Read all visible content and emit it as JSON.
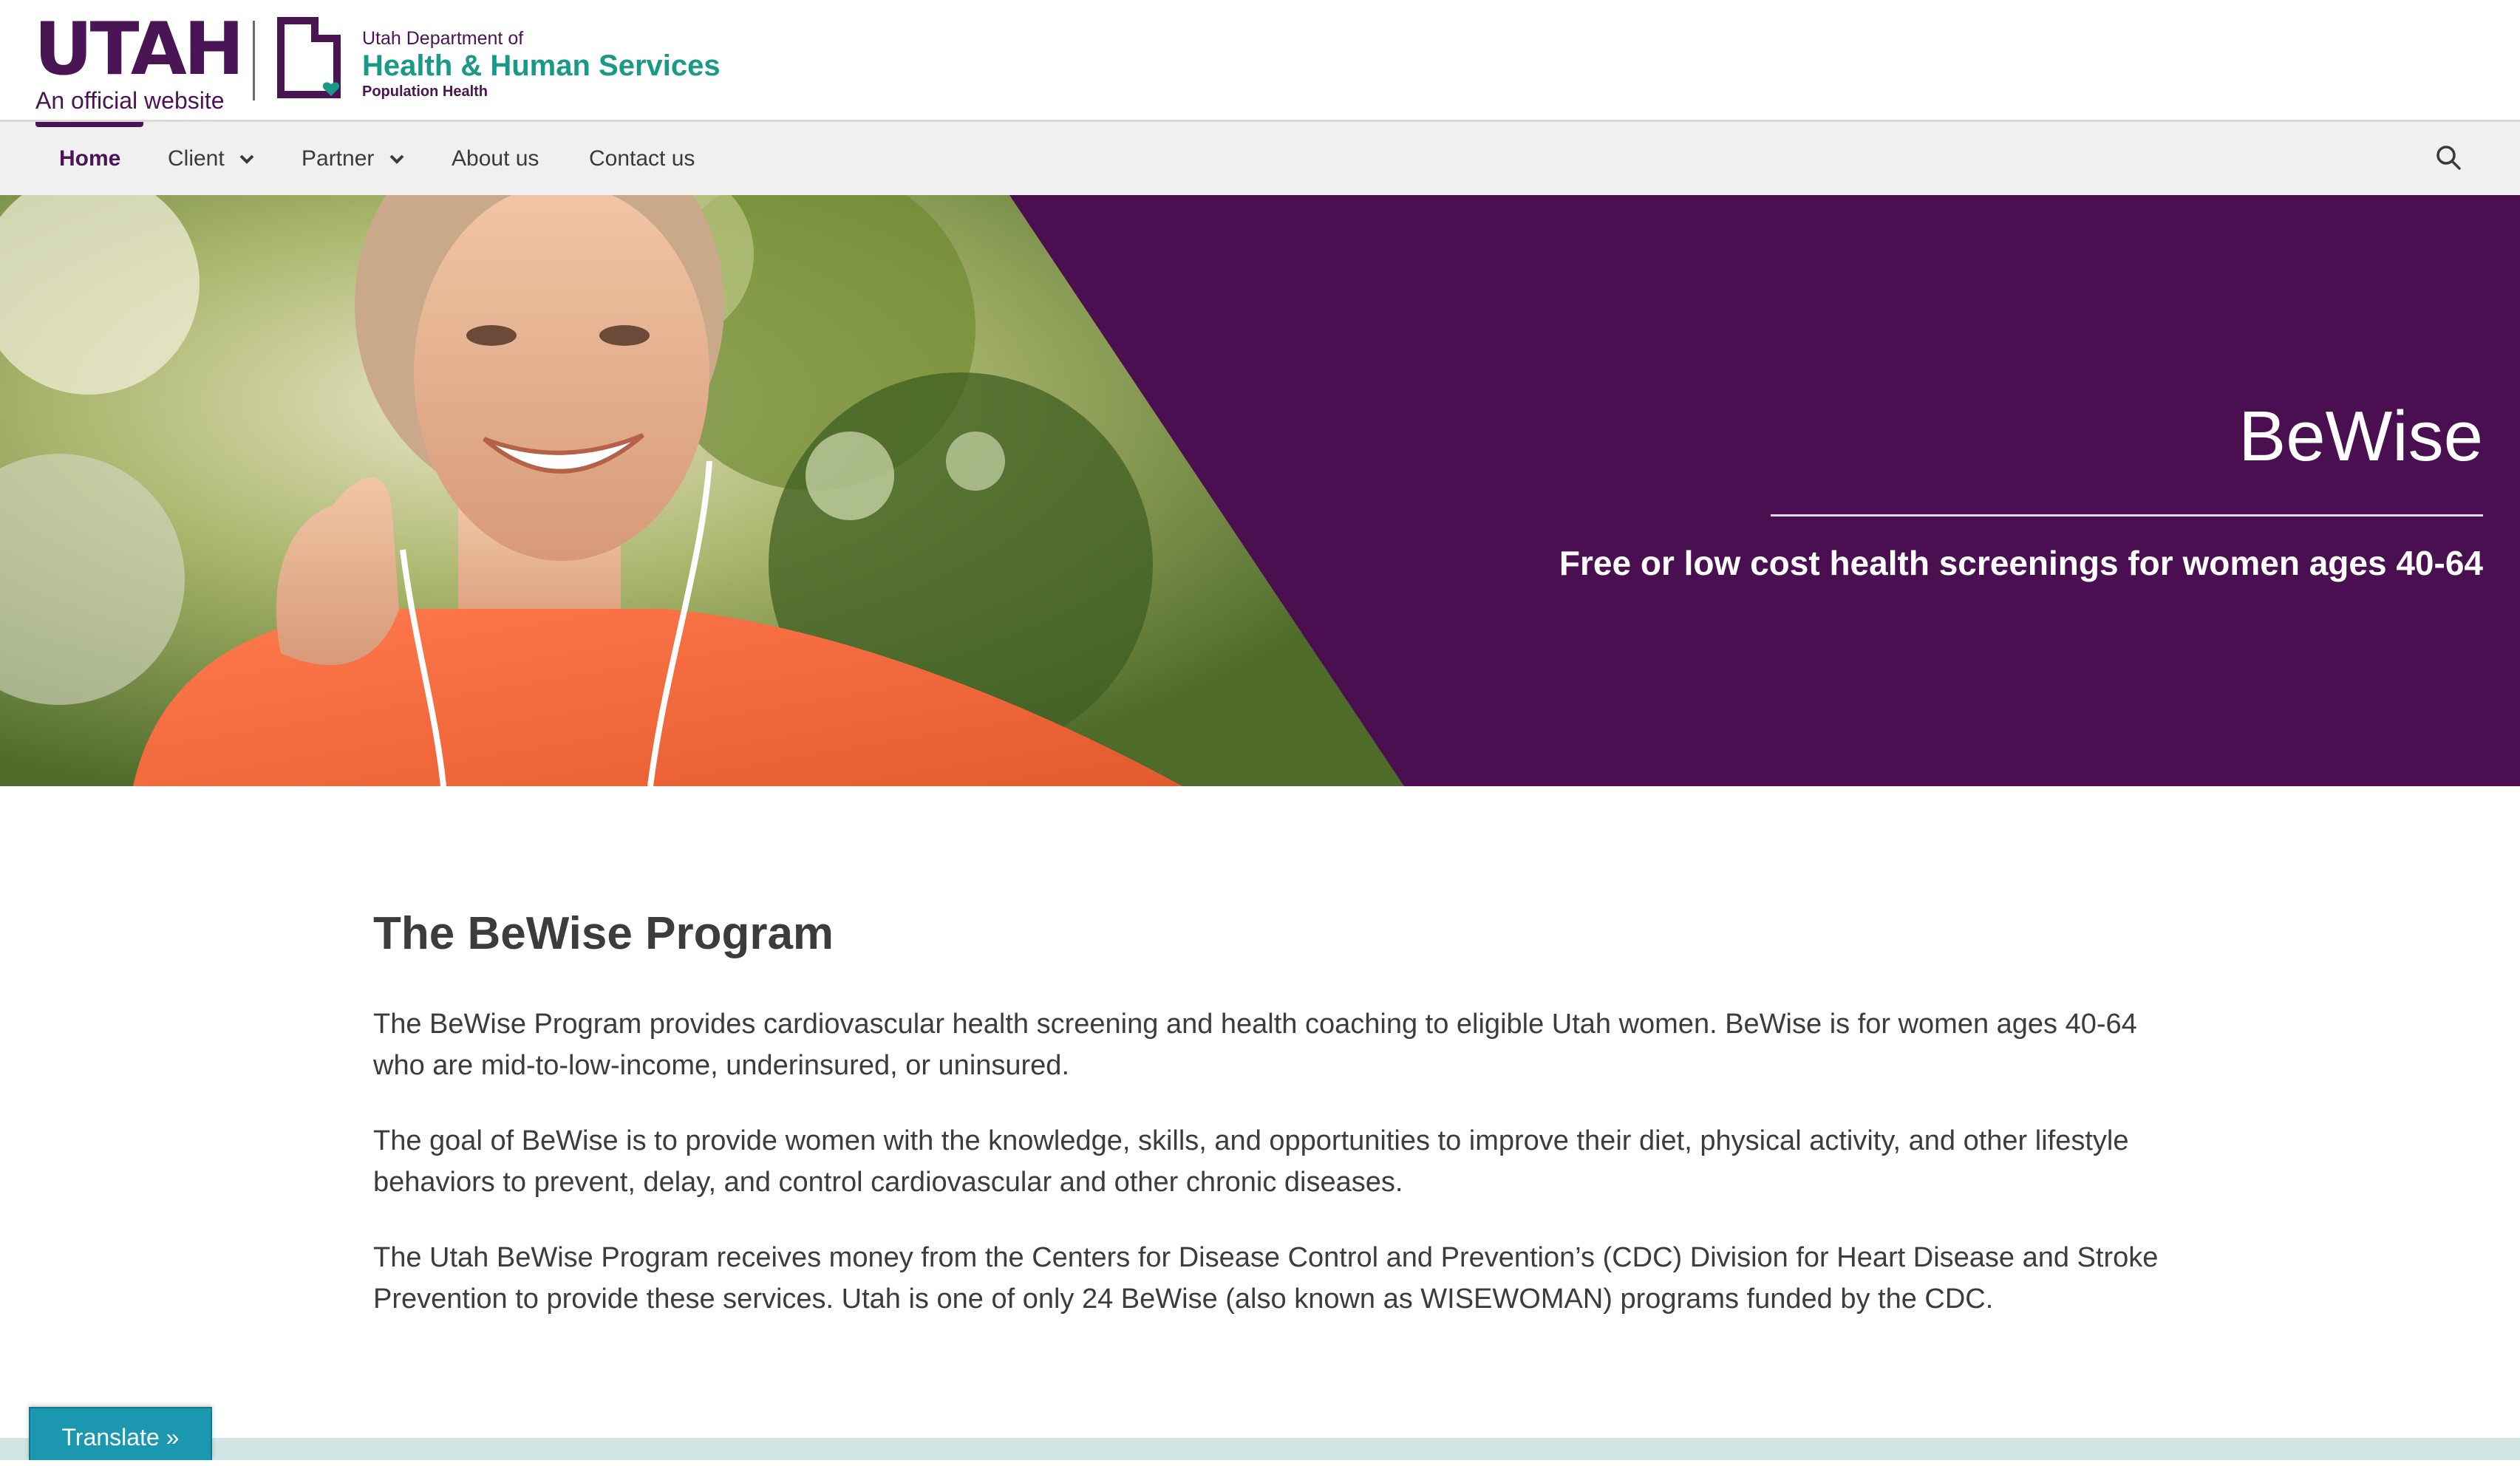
{
  "header": {
    "utah_logo_word": "UTAH",
    "utah_logo_subtitle": "An official website",
    "dept_line1": "Utah Department of",
    "dept_line2": "Health & Human Services",
    "dept_line3": "Population Health"
  },
  "nav": {
    "items": [
      {
        "label": "Home",
        "active": true,
        "has_dropdown": false
      },
      {
        "label": "Client",
        "active": false,
        "has_dropdown": true
      },
      {
        "label": "Partner",
        "active": false,
        "has_dropdown": true
      },
      {
        "label": "About us",
        "active": false,
        "has_dropdown": false
      },
      {
        "label": "Contact us",
        "active": false,
        "has_dropdown": false
      }
    ],
    "search_icon": "search-icon"
  },
  "hero": {
    "title": "BeWise",
    "subtitle": "Free or low cost health screenings for women ages 40-64",
    "background_color": "#4a0f51"
  },
  "main": {
    "heading": "The BeWise Program",
    "paragraphs": [
      "The BeWise Program provides cardiovascular health screening and health coaching to eligible Utah women. BeWise is for women ages 40-64 who are mid-to-low-income, underinsured, or uninsured.",
      "The goal of BeWise is to provide women with the knowledge, skills, and opportunities to improve their diet, physical activity, and other lifestyle behaviors to prevent, delay, and control cardiovascular and other chronic diseases.",
      "The Utah BeWise Program receives money from the Centers for Disease Control and Prevention’s (CDC) Division for Heart Disease and Stroke Prevention to provide these services. Utah is one of only 24 BeWise (also known as WISEWOMAN) programs funded by the CDC."
    ]
  },
  "translate": {
    "label": "Translate »"
  },
  "colors": {
    "brand_purple": "#4b1454",
    "brand_teal": "#1a9988",
    "translate_blue": "#1b97b0"
  }
}
